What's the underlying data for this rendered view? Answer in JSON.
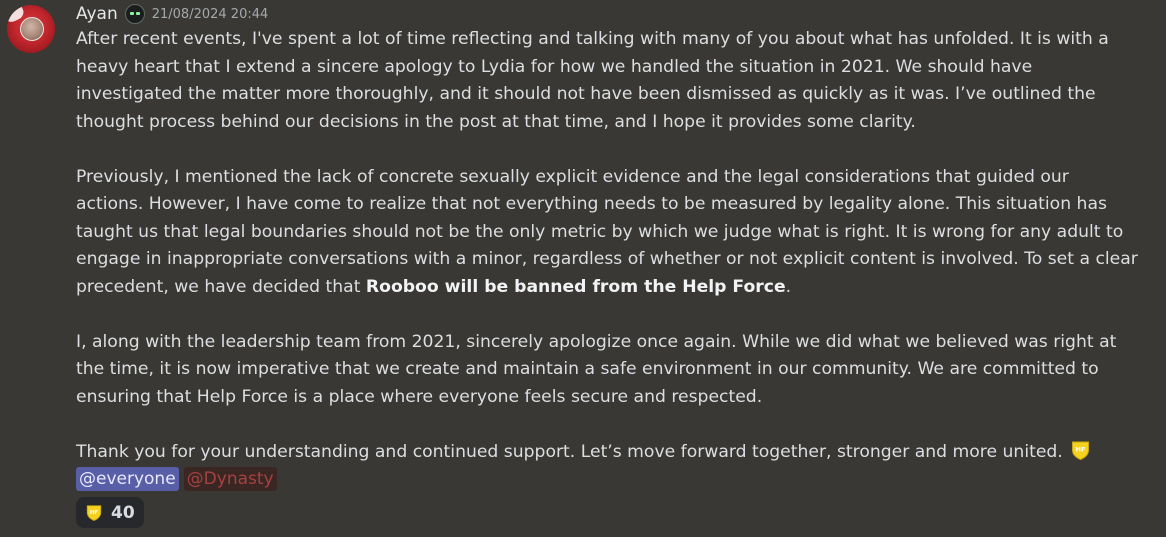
{
  "user": {
    "name": "Ayan",
    "timestamp": "21/08/2024 20:44",
    "avatar_icon": "poppy-avatar",
    "role_icon": "glasses-face-icon"
  },
  "message": {
    "paragraphs": [
      {
        "text": "After recent events, I've spent a lot of time reflecting and talking with many of you about what has unfolded. It is with a heavy heart that I extend a sincere apology to Lydia for how we handled the situation in 2021. We should have investigated the matter more thoroughly, and it should not have been dismissed as quickly as it was. I’ve outlined the thought process behind our decisions in the post at that time, and I hope it provides some clarity."
      },
      {
        "before": "Previously, I mentioned the lack of concrete sexually explicit evidence and the legal considerations that guided our actions. However, I have come to realize that not everything needs to be measured by legality alone. This situation has taught us that legal boundaries should not be the only metric by which we judge what is right. It is wrong for any adult to engage in inappropriate conversations with a minor, regardless of whether or not explicit content is involved. To set a clear precedent, we have decided that ",
        "bold": "Rooboo will be banned from the Help Force",
        "after": "."
      },
      {
        "text": "I, along with the leadership team from 2021, sincerely apologize once again. While we did what we believed was right at the time, it is now imperative that we create and maintain a safe environment in our community. We are committed to ensuring that Help Force is a place where everyone feels secure and respected."
      },
      {
        "text": "Thank you for your understanding and continued support. Let’s move forward together, stronger and more united.",
        "emoji": "hf-shield-emoji"
      }
    ],
    "mentions": [
      {
        "label": "@everyone",
        "color": "#595fa7"
      },
      {
        "label": "@Dynasty",
        "color": "#a5423f"
      }
    ]
  },
  "reactions": [
    {
      "emoji": "hf-shield-emoji",
      "count": "40"
    }
  ],
  "colors": {
    "background": "#393834",
    "text": "#dcdee1",
    "timestamp": "#a4a9ad",
    "reaction_bg": "#26282b",
    "shield_yellow": "#f4d21f"
  }
}
